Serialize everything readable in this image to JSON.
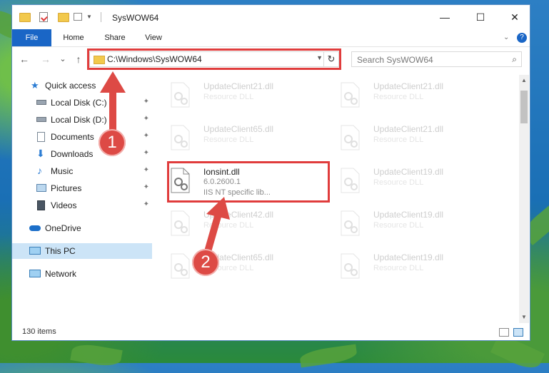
{
  "window": {
    "title": "SysWOW64",
    "controls": {
      "minimize": "—",
      "maximize": "☐",
      "close": "✕"
    }
  },
  "ribbon": {
    "tabs": [
      "File",
      "Home",
      "Share",
      "View"
    ],
    "expand_icon": "chevron-down-icon",
    "help_icon": "help-icon"
  },
  "navigation": {
    "back": "←",
    "forward": "→",
    "recent": "⌄",
    "up": "↑",
    "address": "C:\\Windows\\SysWOW64",
    "refresh": "↻",
    "search_placeholder": "Search SysWOW64",
    "search_icon": "⌕"
  },
  "sidebar": {
    "items": [
      {
        "label": "Quick access",
        "icon": "star-icon",
        "pinned": false
      },
      {
        "label": "Local Disk (C:)",
        "icon": "drive-icon",
        "pinned": true
      },
      {
        "label": "Local Disk (D:)",
        "icon": "drive-icon",
        "pinned": true
      },
      {
        "label": "Documents",
        "icon": "documents-icon",
        "pinned": true
      },
      {
        "label": "Downloads",
        "icon": "download-icon",
        "pinned": true
      },
      {
        "label": "Music",
        "icon": "music-icon",
        "pinned": true
      },
      {
        "label": "Pictures",
        "icon": "pictures-icon",
        "pinned": true
      },
      {
        "label": "Videos",
        "icon": "videos-icon",
        "pinned": true
      },
      {
        "label": "OneDrive",
        "icon": "cloud-icon",
        "pinned": false
      },
      {
        "label": "This PC",
        "icon": "computer-icon",
        "pinned": false,
        "selected": true
      },
      {
        "label": "Network",
        "icon": "network-icon",
        "pinned": false
      }
    ],
    "pin_glyph": "📌"
  },
  "files": [
    {
      "name": "UpdateClient21.dll",
      "type": "Resource DLL",
      "faded": true
    },
    {
      "name": "UpdateClient21.dll",
      "type": "Resource DLL",
      "faded": true
    },
    {
      "name": "UpdateClient65.dll",
      "type": "Resource DLL",
      "faded": true
    },
    {
      "name": "UpdateClient21.dll",
      "type": "Resource DLL",
      "faded": true
    },
    {
      "name": "Ionsint.dll",
      "version": "6.0.2600.1",
      "type": "IIS NT specific lib...",
      "faded": false
    },
    {
      "name": "UpdateClient19.dll",
      "type": "Resource DLL",
      "faded": true
    },
    {
      "name": "UpdateClient42.dll",
      "type": "Resource DLL",
      "faded": true
    },
    {
      "name": "UpdateClient19.dll",
      "type": "Resource DLL",
      "faded": true
    },
    {
      "name": "UpdateClient65.dll",
      "type": "Resource DLL",
      "faded": true
    },
    {
      "name": "UpdateClient19.dll",
      "type": "Resource DLL",
      "faded": true
    }
  ],
  "status": {
    "item_count": "130 items"
  },
  "annotations": {
    "step1": "1",
    "step2": "2",
    "color": "#e03c3c"
  }
}
